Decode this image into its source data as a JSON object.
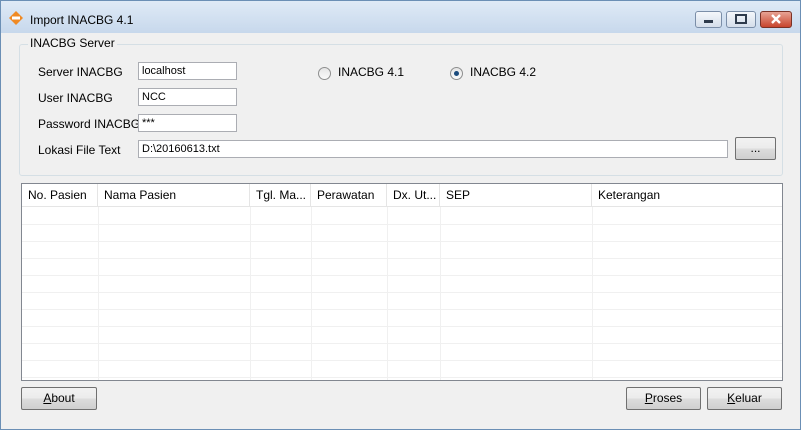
{
  "window": {
    "title": "Import INACBG 4.1"
  },
  "group": {
    "title": "INACBG Server"
  },
  "form": {
    "server_label": "Server INACBG",
    "server_value": "localhost",
    "user_label": "User INACBG",
    "user_value": "NCC",
    "password_label": "Password INACBG",
    "password_value": "***",
    "file_label": "Lokasi File Text",
    "file_value": "D:\\20160613.txt",
    "browse_label": "..."
  },
  "radios": {
    "v41_label": "INACBG 4.1",
    "v42_label": "INACBG 4.2",
    "selected": "INACBG 4.2"
  },
  "table": {
    "columns": [
      "No. Pasien",
      "Nama Pasien",
      "Tgl. Ma...",
      "Perawatan",
      "Dx. Ut...",
      "SEP",
      "Keterangan"
    ],
    "rows": []
  },
  "buttons": {
    "about_first": "A",
    "about_rest": "bout",
    "proses_first": "P",
    "proses_rest": "roses",
    "keluar_first": "K",
    "keluar_rest": "eluar"
  },
  "colors": {
    "accent": "#3c7fb1",
    "titlebar": "#c7d8ec",
    "close": "#c8442c"
  }
}
